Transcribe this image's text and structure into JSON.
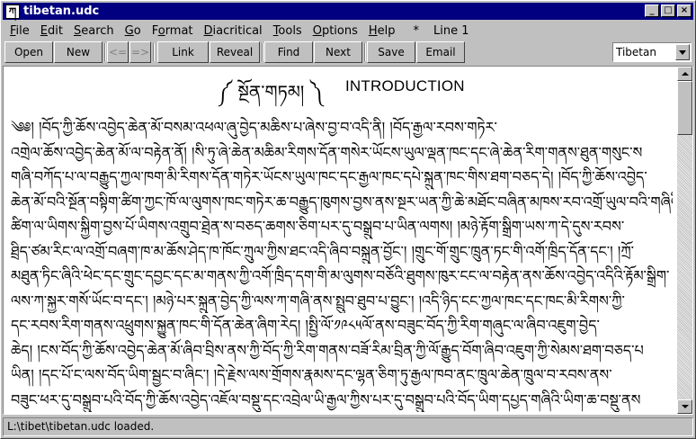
{
  "window": {
    "title": "tibetan.udc",
    "app_icon": "tibetan-editor-icon",
    "controls": [
      "_",
      "□",
      "×"
    ]
  },
  "menu": {
    "items": [
      {
        "label": "File",
        "mnemonic": "F"
      },
      {
        "label": "Edit",
        "mnemonic": "E"
      },
      {
        "label": "Search",
        "mnemonic": "S"
      },
      {
        "label": "Go",
        "mnemonic": "G"
      },
      {
        "label": "Format",
        "mnemonic": "o"
      },
      {
        "label": "Diacritical",
        "mnemonic": "D"
      },
      {
        "label": "Tools",
        "mnemonic": "T"
      },
      {
        "label": "Options",
        "mnemonic": "O"
      },
      {
        "label": "Help",
        "mnemonic": "H"
      }
    ],
    "modified_flag": "*",
    "line_indicator": "Line 1"
  },
  "toolbar": {
    "open": "Open",
    "new": "New",
    "back": "<=",
    "forward": "=>",
    "link": "Link",
    "reveal": "Reveal",
    "find": "Find",
    "next": "Next",
    "save": "Save",
    "email": "Email",
    "font_select": "Tibetan"
  },
  "document": {
    "tibetan_heading": "༼ སྔོན་གཏམ། ༽",
    "heading": "INTRODUCTION",
    "lines": [
      "        ༄༅། །བོད་ཀྱི་ཆོས་འབྱེད་ཆེན་མོ་བསམ་འཕལ་ཞུ་བྱེད་མཆིས་པ་ཞེས་བྱ་བ་འདི་ནི། །བོད་རྒྱལ་རབས་གཏེར་",
      "འགྲེལ་ཆོས་འབྱེད་ཆེན་མོ་ལ་བརྟེན་ནོ། །སི་ཏུ་ཞེ་ཆེན་མཆིམ་རིགས་དོན་གསེར་ཡོངས་ཡུལ་ལྡན་ཁང་དང་ཞེ་ཆེན་རིག་གནས་ཐུན་གསུང་ས",
      "གཞི་བཀོད་པ་ལ་བརྒྱུད་ཀྱལ་ཁག་མི་རིགས་དོན་གཏེར་ཡོངས་ཡུལ་ཁང་དང་རྒྱལ་ཁང་དཔེ་སྐྲུན་ཁང་གིས་ཐག་བཅད་དེ། །བོད་ཀྱི་ཆོས་འབྱེད་",
      "ཆེན་མོ་བའི་སྔོན་བསྟིག་ཚིག་ཀྱང་ཁོ་ལ་ལུགས་ཁང་གཏེར་ཆ་བརྒྱུད་ཁུགས་བྱས་ནས་སྔར་ཡན་ཀྱི་ཆེ་མཐོང་བཞིན་མཁས་རབ་འགྲོ་ཡུལ་བའི་གཞིའི་",
      "ཚིག་ལ་ཡིགས་སྐྱིག་བྱས་པོ་ཡིགས་འགྲུབ་ཐྲེན་ས་བཅད་ཆགས་ཅིག་པར་དུ་བསྒྲུབ་པ་ཡིན་ལགས། །མཉེ་རྟོག་སྒྲིག་ཡས་ཀ་དེ་དུས་རབས་",
      "ཐྲིད་ཙམ་རིང་ལ་འགྲོ་བཞག་ཁ་མ་ཆོས་ཤེད་ཁ་ཁོང་ཀྲུལ་ཀྱིས་ཐང་འདི་ཞིབ་བསྐྲུན་བྱོང་། །གྲུང་གོ་གྲུང་ཁྲུན་ཏང་གི་འགོ་ཁྲིད་དོན་དང་། །ཀྲོ་",
      "མཐུན་ཏིང་ཞིའི་ཕེང་དང་གྲུང་དབྱང་དང་མ་གནས་ཀྱི་འགོ་ཁྲིད་དག་གི་མ་ལུགས་བཅོའི་ཐུགས་ཁུར་ངང་ལ་བརྟེན་ནས་ཆོས་འབྱེད་འདིའི་རྟོམ་སྒྲིག་",
      "ལས་ཀ་སྐྱར་གསོ་ཡོང་བ་དང་། །མཉེ་པར་སྐྲུན་བྱེད་ཀྱི་ལས་ཀ་གཞི་ནས་སྤྲུབ་ཐུབ་པ་བྱུང་། །འདི་ཉིད་ངང་ཀྱལ་ཁང་དང་ཁང་མི་རིགས་ཀྱི་",
      "དང་རབས་རིག་གནས་འཕྲུགས་སྐྱུན་ཁང་གི་དོན་ཆེན་ཞིག་རེད། །སྤྱི་ལོ་༡༩༨༥ལོ་ནས་བཟུང་བོད་ཀྱི་རིག་གཞུང་ལ་ཞིབ་འཇུག་བྱེད་",
      "ཆེད། །ངས་བོད་ཀྱི་ཆོས་འབྱེད་ཆེན་མོ་ཞིབ་བྲིས་ནས་ཀྱི་བོད་ཀྱི་རིག་གནས་བཟོ་རིམ་བྲིན་ཀྱི་ལོ་རྒྱུད་བོག་ཞིབ་འཇུག་ཀྱི་སེམས་ཐག་བཅད་པ",
      "ཡིན། །དང་པོ་ང་ལས་བོད་ཡིག་སྦྱང་བ་ཞིང་། །དེ་རྗེས་ལས་གྲོགས་རྣམས་དང་ལྷན་ཅིག་ཏུ་རྒྱལ་ཁབ་ནང་ཁྲུལ་ཆེན་ཁྲུལ་བ་རབས་ནས་",
      "བཟུང་ཕར་དུ་བསྒྲུབ་པའི་བོད་ཀྱི་ཆོས་འབྱེད་འཇོལ་བསྡུ་དང་འབྲེལ་ཡི་རྒྱལ་ཀྱིས་པར་དུ་བསྒྲུབ་པའི་བོད་ཡིག་དཔྱད་གཞིའི་ཡིག་ཆ་བསྡུ་ནས"
    ]
  },
  "status": {
    "message": "L:\\tibet\\tibetan.udc loaded."
  }
}
